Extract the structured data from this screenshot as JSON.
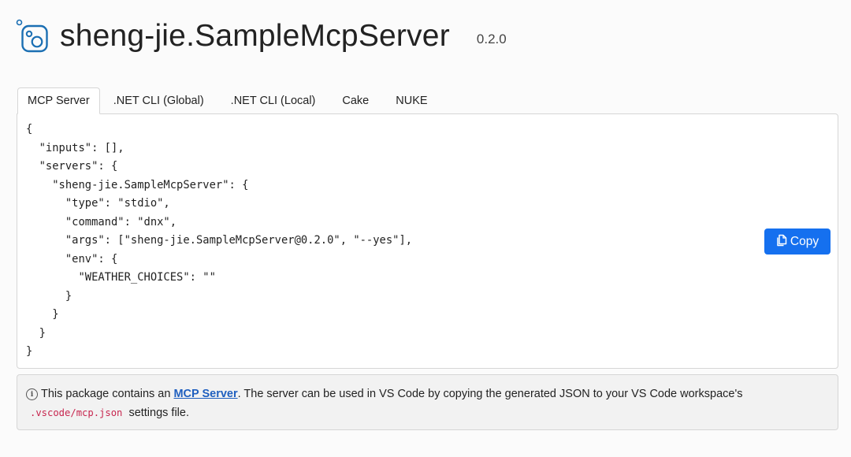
{
  "header": {
    "icon": "package-icon",
    "title": "sheng-jie.SampleMcpServer",
    "version": "0.2.0"
  },
  "tabs": [
    {
      "label": "MCP Server",
      "active": true
    },
    {
      "label": ".NET CLI (Global)",
      "active": false
    },
    {
      "label": ".NET CLI (Local)",
      "active": false
    },
    {
      "label": "Cake",
      "active": false
    },
    {
      "label": "NUKE",
      "active": false
    }
  ],
  "code": {
    "lines": [
      "{",
      "  \"inputs\": [],",
      "  \"servers\": {",
      "    \"sheng-jie.SampleMcpServer\": {",
      "      \"type\": \"stdio\",",
      "      \"command\": \"dnx\",",
      "      \"args\": [\"sheng-jie.SampleMcpServer@0.2.0\", \"--yes\"],",
      "      \"env\": {",
      "        \"WEATHER_CHOICES\": \"\"",
      "      }",
      "    }",
      "  }",
      "}"
    ]
  },
  "copy_button": {
    "label": "Copy",
    "icon": "copy-icon",
    "color": "#1570ef"
  },
  "note": {
    "icon": "info-icon",
    "text_before": "This package contains an",
    "link_text": "MCP Server",
    "text_after": ". The server can be used in VS Code by copying the generated JSON to your VS Code workspace's",
    "file_path": ".vscode/mcp.json",
    "text_end": "settings file."
  },
  "colors": {
    "accent": "#1570ef",
    "link": "#1f5fbf",
    "code_path": "#c7254e"
  }
}
